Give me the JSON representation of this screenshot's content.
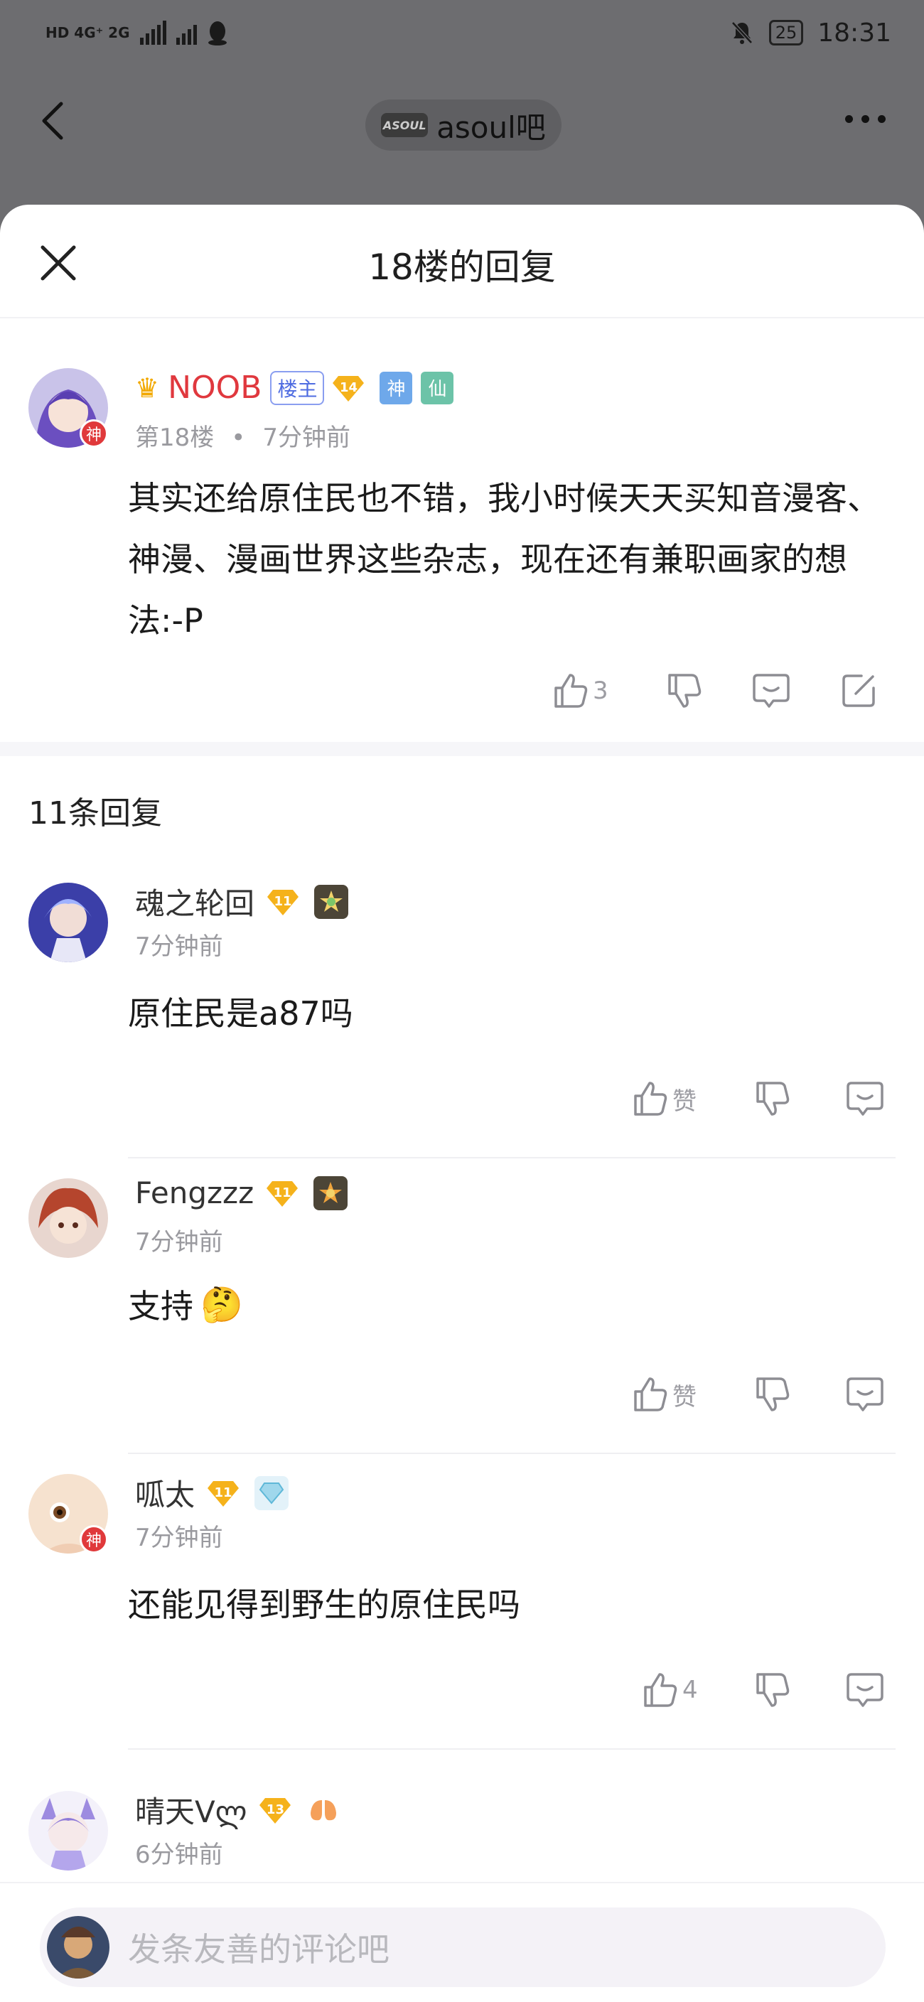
{
  "status_bar": {
    "left": "HD 4G⁺ 2G",
    "battery": "25",
    "time": "18:31"
  },
  "nav": {
    "forum_logo_text": "ASOUL",
    "forum_name": "asoul吧"
  },
  "sheet": {
    "title": "18楼的回复"
  },
  "main_post": {
    "author": "NOOB",
    "op_tag": "楼主",
    "level": "14",
    "title_badges": [
      "神",
      "仙"
    ],
    "avatar_badge": "神",
    "floor": "第18楼",
    "time": "7分钟前",
    "content": "其实还给原住民也不错，我小时候天天买知音漫客、神漫、漫画世界这些杂志，现在还有兼职画家的想法:-P",
    "like_count": "3"
  },
  "replies_header": "11条回复",
  "replies": [
    {
      "name": "魂之轮回",
      "level": "11",
      "time": "7分钟前",
      "content": "原住民是a87吗",
      "like": "赞",
      "avatar_badge": ""
    },
    {
      "name": "Fengzzz",
      "level": "11",
      "time": "7分钟前",
      "content": "支持",
      "emoji": "🤔",
      "like": "赞",
      "avatar_badge": ""
    },
    {
      "name": "呱太",
      "level": "11",
      "time": "7分钟前",
      "content": "还能见得到野生的原住民吗",
      "like": "4",
      "avatar_badge": "神"
    },
    {
      "name": "晴天Vლ",
      "level": "13",
      "time": "6分钟前",
      "content": "",
      "like": "",
      "avatar_badge": ""
    }
  ],
  "input": {
    "placeholder": "发条友善的评论吧"
  },
  "colors": {
    "op_name": "#e0383e",
    "level_badge": "#f5b21b",
    "avatar_badge": "#e0393b",
    "op_tag": "#4f6ce1"
  }
}
